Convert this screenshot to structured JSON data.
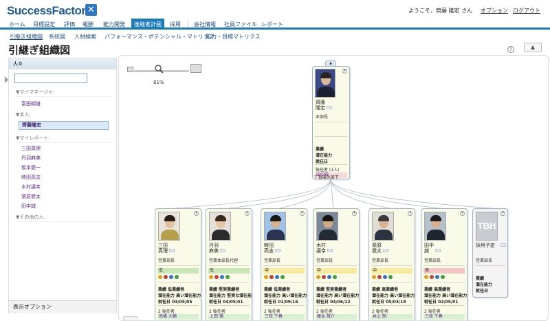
{
  "header": {
    "logo_text": "SuccessFactors",
    "logo_mark": "✕",
    "welcome": "ようこそ、齊藤 隆宏 さん",
    "options_link": "オプション",
    "logout_link": "ログアウト"
  },
  "nav": {
    "items": [
      {
        "label": "ホーム"
      },
      {
        "label": "目標設定"
      },
      {
        "label": "評価"
      },
      {
        "label": "報酬"
      },
      {
        "label": "能力開発"
      },
      {
        "label": "後継者計画"
      },
      {
        "label": "採用"
      },
      {
        "label": "会社情報"
      },
      {
        "label": "社員ファイル"
      },
      {
        "label": "レポート"
      }
    ],
    "active_index": 5
  },
  "subnav": {
    "items": [
      {
        "label": "引継ぎ組織図"
      },
      {
        "label": "系統図"
      },
      {
        "label": "人材検索"
      },
      {
        "label": "パフォーマンス・ポテンシャル・マトリクス"
      },
      {
        "label": "能力・目標マトリクス"
      }
    ]
  },
  "page": {
    "title": "引継ぎ組織図",
    "help_icon": "?",
    "collapse_icon": "▲"
  },
  "left_panel": {
    "header": "人々",
    "search_value": "",
    "sections": {
      "my_manager": "▼マイマネージャ:",
      "self": "▼本人:",
      "reports": "▼マイレポート:",
      "others": "▼その他の人:"
    },
    "manager": "富田朝雄",
    "self_name": "齊藤隆宏",
    "reports": [
      "三田真理",
      "丹羽麻美",
      "坂本健一",
      "時田高志",
      "木村譲幸",
      "栗原健太",
      "田中誠"
    ],
    "footer": "表示オプション"
  },
  "zoom": {
    "value": "81%"
  },
  "root_card": {
    "collapse_icon": "▲",
    "name_line1": "齊藤",
    "name_line2": "隆宏",
    "role": "本部長",
    "labels": {
      "performance": "業績",
      "potential": "潜在能力",
      "tenure": "就任日"
    },
    "successor_label": "後任者 (1人)",
    "successor_name": "田中誠",
    "direct_reports": "7 直属の部下"
  },
  "cards": [
    {
      "name1": "三田",
      "name2": "真理",
      "role": "営業部長",
      "rating": "低",
      "perf": "業績 低業績者",
      "pot": "潜在能力 高い潜在能力",
      "tenure": "就任日 03/05/05",
      "succ_label": "2 後任者",
      "succ_name": "高橋 大輔"
    },
    {
      "name1": "丹羽",
      "name2": "麻美",
      "role": "営業本部長代理",
      "rating": "低",
      "perf": "業績 堅実業績者",
      "pot": "潜在能力 堅実な潜在能力",
      "tenure": "就任日 04/05/01",
      "succ_label": "2 後任者",
      "succ_name": "上田 彌"
    },
    {
      "name1": "時田",
      "name2": "高志",
      "role": "営業部長",
      "rating": "中",
      "perf": "業績 低業績者",
      "pot": "潜在能力 高い潜在能力",
      "tenure": "就任日 01/09/16",
      "succ_label": "2 後任者",
      "succ_name": "三枝 千春"
    },
    {
      "name1": "木村",
      "name2": "譲幸",
      "role": "営業部長",
      "rating": "中",
      "perf": "業績 堅実業績者",
      "pot": "潜在能力 高い潜在能力",
      "tenure": "就任日 04/06/12",
      "succ_label": "2 後任者",
      "succ_name": "藤本 雄介"
    },
    {
      "name1": "栗原",
      "name2": "健太",
      "role": "営業部長",
      "rating": "中",
      "perf": "業績 高業績者",
      "pot": "潜在能力 高い潜在能力",
      "tenure": "就任日 05/03/18",
      "succ_label": "2 後任者",
      "succ_name": "井上 剛"
    },
    {
      "name1": "田中",
      "name2": "誠",
      "role": "営業部長",
      "rating": "高",
      "perf": "業績 高業績者",
      "pot": "潜在能力 高い潜在能力",
      "tenure": "就任日 02/05/01",
      "succ_label": "2 後任者",
      "succ_name": "三枝 千春"
    },
    {
      "name1": "採用予定",
      "name2": "",
      "role": "営業部長",
      "tbh": "TBH",
      "perf": "業績",
      "pot": "潜在能力",
      "tenure": "就任日"
    }
  ],
  "colors": {
    "accent": "#1b7ab8",
    "card_bg": "#fafae8",
    "rating_low": "#c8e6b8",
    "rating_mid": "#f6eaa0",
    "rating_high": "#f3c6c6",
    "successor_bg": "#f7d8d8"
  },
  "icons": [
    "search-icon",
    "help-icon",
    "collapse-icon",
    "card-menu-icon",
    "zoom-image-icon"
  ]
}
